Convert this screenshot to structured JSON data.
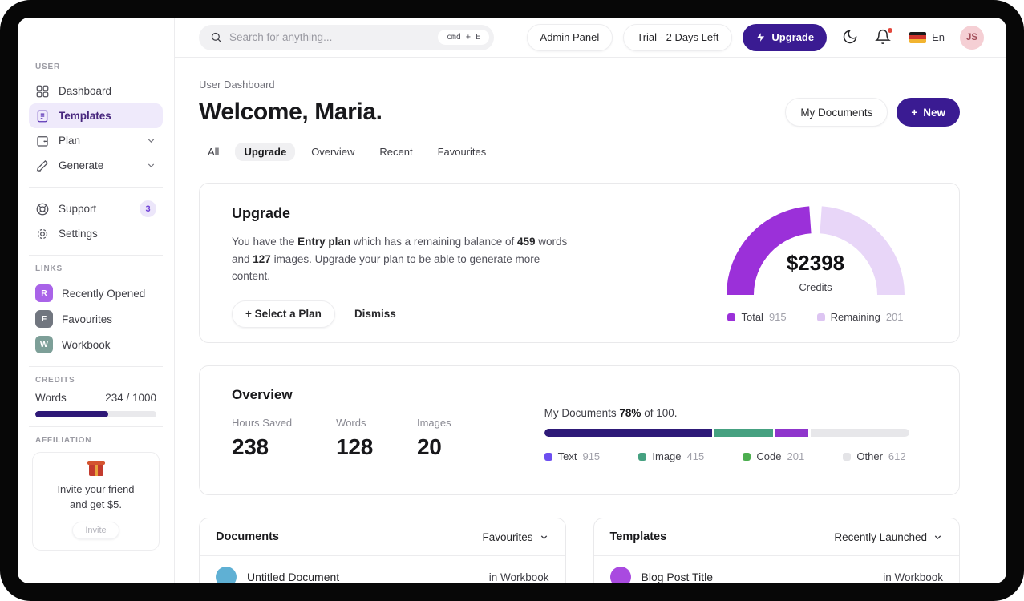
{
  "topbar": {
    "search": {
      "placeholder": "Search for anything...",
      "shortcut": "cmd + E"
    },
    "admin_panel": "Admin Panel",
    "trial": "Trial - 2 Days Left",
    "upgrade": "Upgrade",
    "locale": "En",
    "avatar_initials": "JS"
  },
  "sidebar": {
    "section_user": "User",
    "nav": [
      {
        "label": "Dashboard"
      },
      {
        "label": "Templates"
      },
      {
        "label": "Plan"
      },
      {
        "label": "Generate"
      }
    ],
    "support": {
      "label": "Support",
      "badge": "3"
    },
    "settings": {
      "label": "Settings"
    },
    "section_links": "Links",
    "links": [
      {
        "initial": "R",
        "label": "Recently Opened",
        "color": "#a963e8"
      },
      {
        "initial": "F",
        "label": "Favourites",
        "color": "#71767f"
      },
      {
        "initial": "W",
        "label": "Workbook",
        "color": "#7d9f98"
      }
    ],
    "section_credits": "Credits",
    "credits": {
      "label": "Words",
      "value": "234 / 1000",
      "percent": 60,
      "bar_color": "#2e1877"
    },
    "section_affiliation": "Affiliation",
    "affiliation": {
      "line1": "Invite your friend",
      "line2": "and get $5.",
      "button": "Invite"
    }
  },
  "header": {
    "breadcrumb": "User Dashboard",
    "title": "Welcome, Maria.",
    "my_documents": "My Documents",
    "new_label": "New",
    "plus": "+"
  },
  "tabs": {
    "items": [
      "All",
      "Upgrade",
      "Overview",
      "Recent",
      "Favourites"
    ],
    "active": "Upgrade"
  },
  "upgrade_card": {
    "title": "Upgrade",
    "body": {
      "pre": "You have the ",
      "plan": "Entry plan",
      "mid1": " which has a remaining balance of ",
      "words": "459",
      "mid2": " words and ",
      "images": "127",
      "post": " images. Upgrade your plan to be able to generate more content."
    },
    "select_plan": "+ Select a Plan",
    "dismiss": "Dismiss",
    "gauge": {
      "value": "$2398",
      "label": "Credits",
      "filled_color": "#9b30d9",
      "remaining_color": "#e8d6f8",
      "legend": [
        {
          "label": "Total",
          "value": "915",
          "color": "#9b30d9"
        },
        {
          "label": "Remaining",
          "value": "201",
          "color": "#ddc5f2"
        }
      ]
    }
  },
  "overview_card": {
    "title": "Overview",
    "stats": [
      {
        "label": "Hours Saved",
        "value": "238"
      },
      {
        "label": "Words",
        "value": "128"
      },
      {
        "label": "Images",
        "value": "20"
      }
    ],
    "progress": {
      "prefix": "My Documents ",
      "percent": "78%",
      "suffix": " of 100.",
      "track_color": "#e7e7ea",
      "segments": [
        {
          "color": "#2e1a78",
          "pct": 46
        },
        {
          "color": "#46a181",
          "pct": 16
        },
        {
          "color": "#8f35cc",
          "pct": 9
        }
      ],
      "legend": [
        {
          "label": "Text",
          "value": "915",
          "color": "#6d4ff0"
        },
        {
          "label": "Image",
          "value": "415",
          "color": "#46a181"
        },
        {
          "label": "Code",
          "value": "201",
          "color": "#4cae4f"
        },
        {
          "label": "Other",
          "value": "612",
          "color": "#e4e4e7"
        }
      ]
    }
  },
  "documents_card": {
    "title": "Documents",
    "filter": "Favourites",
    "items": [
      {
        "name": "Untitled Document",
        "location": "in Workbook",
        "color": "#5fb0d4"
      }
    ]
  },
  "templates_card": {
    "title": "Templates",
    "filter": "Recently Launched",
    "items": [
      {
        "name": "Blog Post Title",
        "location": "in Workbook",
        "color": "#a94ae0"
      }
    ]
  }
}
